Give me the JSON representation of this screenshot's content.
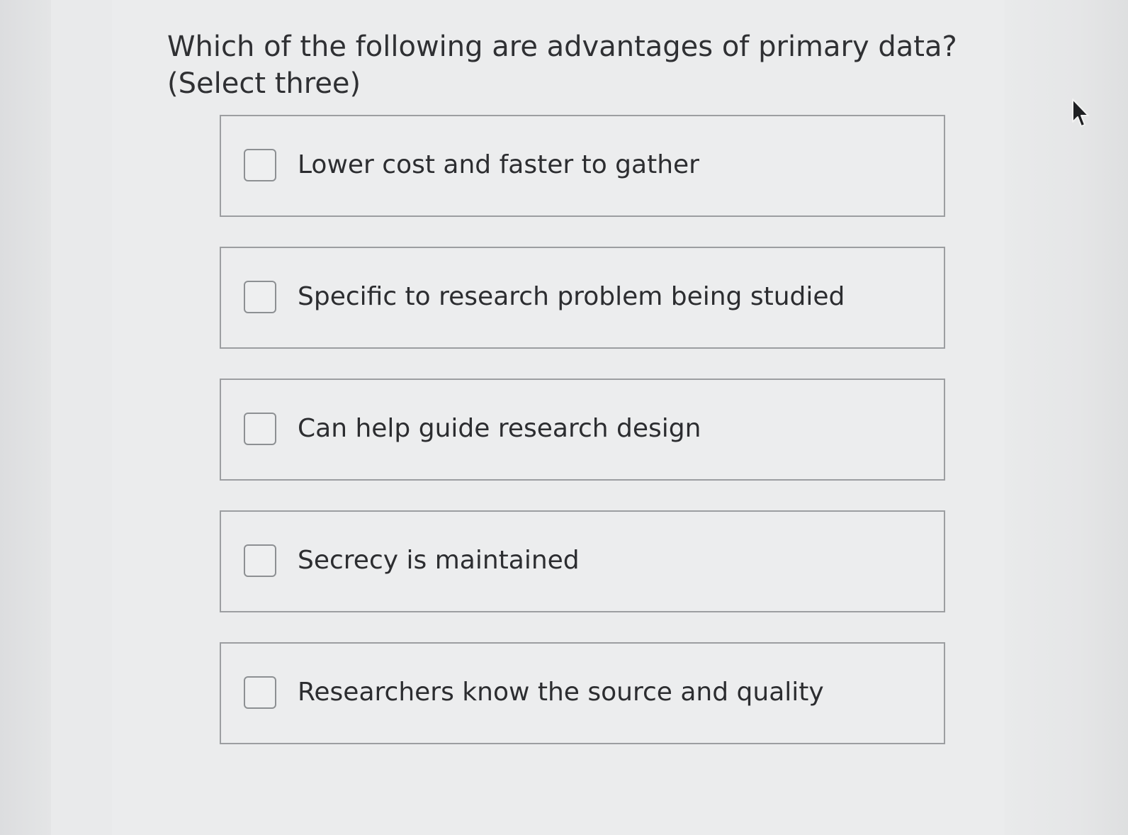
{
  "question": {
    "text": "Which of the following are advantages of primary data? (Select three)"
  },
  "options": [
    {
      "label": "Lower cost and faster to gather",
      "checked": false
    },
    {
      "label": "Specific to research problem being studied",
      "checked": false
    },
    {
      "label": "Can help guide research design",
      "checked": false
    },
    {
      "label": "Secrecy is maintained",
      "checked": false
    },
    {
      "label": "Researchers know the source and quality",
      "checked": false
    }
  ],
  "colors": {
    "panel_background": "#ebeced",
    "option_border": "#9c9ea1",
    "text": "#2c2d30"
  },
  "icons": {
    "pointer": "mouse-pointer-icon",
    "checkbox": "checkbox-empty-icon"
  }
}
